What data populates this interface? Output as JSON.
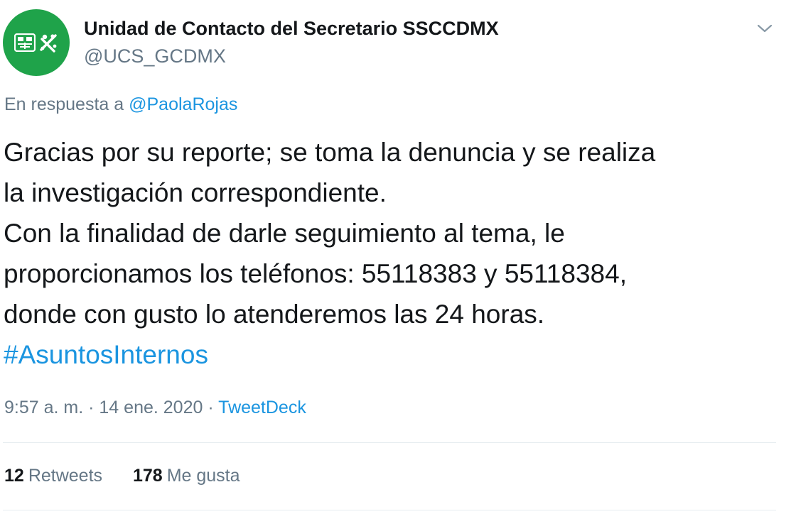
{
  "author": {
    "display_name": "Unidad de Contacto del Secretario SSCCDMX",
    "handle": "@UCS_GCDMX",
    "avatar_color": "#1fa34a"
  },
  "reply": {
    "prefix": "En respuesta a",
    "mention": "@PaolaRojas"
  },
  "body": {
    "lines": [
      "Gracias por su reporte; se toma la denuncia y se realiza",
      "la investigación correspondiente.",
      "Con la finalidad de darle seguimiento al tema, le",
      "proporcionamos los teléfonos: 55118383 y 55118384,",
      "donde con gusto lo atenderemos las 24 horas."
    ],
    "hashtag": "#AsuntosInternos"
  },
  "meta": {
    "time": "9:57 a. m.",
    "separator": "·",
    "date": "14 ene. 2020",
    "source": "TweetDeck"
  },
  "stats": {
    "retweets_count": "12",
    "retweets_label": "Retweets",
    "likes_count": "178",
    "likes_label": "Me gusta"
  },
  "icons": {
    "menu": "chevron-down-icon"
  },
  "colors": {
    "link": "#1b95e0",
    "secondary_text": "#657786",
    "primary_text": "#14171a"
  }
}
